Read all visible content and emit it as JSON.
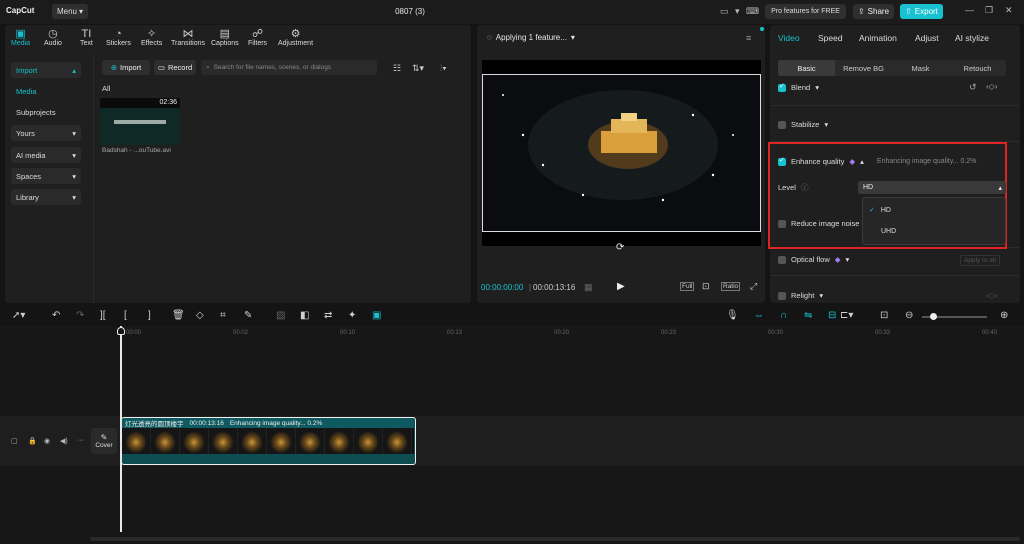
{
  "app": {
    "logo": "CapCut",
    "menu_label": "Menu",
    "doc_title": "0807 (3)",
    "pro_label": "Pro features for FREE",
    "share_label": "Share",
    "export_label": "Export",
    "accent_color": "#17c1cf"
  },
  "media_tabs": [
    {
      "label": "Media",
      "icon": "media-icon",
      "active": true
    },
    {
      "label": "Audio",
      "icon": "audio-icon"
    },
    {
      "label": "Text",
      "icon": "text-icon"
    },
    {
      "label": "Stickers",
      "icon": "stickers-icon"
    },
    {
      "label": "Effects",
      "icon": "effects-icon"
    },
    {
      "label": "Transitions",
      "icon": "transitions-icon"
    },
    {
      "label": "Captions",
      "icon": "captions-icon"
    },
    {
      "label": "Filters",
      "icon": "filters-icon"
    },
    {
      "label": "Adjustment",
      "icon": "adjustment-icon"
    }
  ],
  "sidebar": {
    "items": [
      {
        "label": "Import"
      },
      {
        "label": "Media"
      },
      {
        "label": "Subprojects"
      },
      {
        "label": "Yours"
      },
      {
        "label": "AI media"
      },
      {
        "label": "Spaces"
      },
      {
        "label": "Library"
      }
    ]
  },
  "media": {
    "import_label": "Import",
    "record_label": "Record",
    "search_placeholder": "Search for file names, scenes, or dialogs",
    "filter_all": "All",
    "item": {
      "duration": "02:36",
      "name": "Badshah - ...ouTube.avi"
    }
  },
  "player": {
    "status": "Applying 1 feature...",
    "current_time": "00:00:00:00",
    "total_time": "00:00:13:16",
    "full_label": "Full",
    "ratio_label": "Ratio"
  },
  "right_panel": {
    "tabs": [
      "Video",
      "Speed",
      "Animation",
      "Adjust",
      "AI stylize"
    ],
    "subtabs": [
      "Basic",
      "Remove BG",
      "Mask",
      "Retouch"
    ],
    "blend": "Blend",
    "stabilize": "Stabilize",
    "enhance_quality": "Enhance quality",
    "enhance_status": "Enhancing image quality... 0.2%",
    "level_label": "Level",
    "level_value": "HD",
    "level_options": [
      "HD",
      "UHD"
    ],
    "reduce_noise": "Reduce image noise",
    "optical_flow": "Optical flow",
    "apply_all": "Apply to all",
    "relight": "Relight"
  },
  "timeline": {
    "ticks": [
      "00:00",
      "00:02",
      "00:10",
      "00:13",
      "00:20",
      "00:23",
      "00:30",
      "00:33",
      "00:40"
    ],
    "cover_label": "Cover",
    "clip": {
      "title": "灯光透亮的圆顶楼宇",
      "duration": "00:00:13:16",
      "status": "Enhancing image quality... 0.2%"
    }
  }
}
